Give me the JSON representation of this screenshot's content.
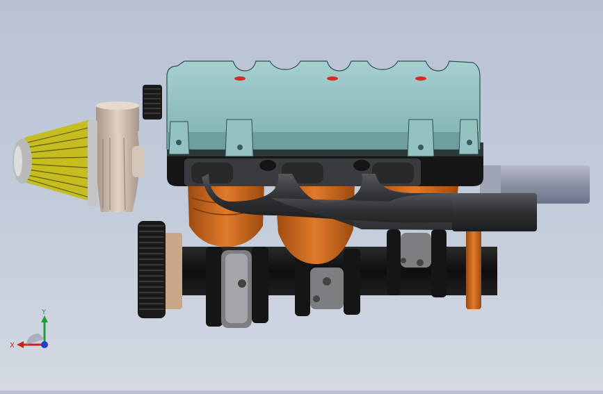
{
  "viewport": {
    "colors": {
      "background_top": "#b8c2d4",
      "background_bottom": "#d4d9e2",
      "valve_cover": "#8fbdbd",
      "valve_cover_dark": "#5f8f8f",
      "head_black": "#1a1a1a",
      "exhaust_pipe": "#3a3a3c",
      "copper": "#c8661b",
      "air_filter": "#b8b018",
      "turbo_housing": "#c9b8a8",
      "intake_pipe": "#8b8fa2"
    }
  },
  "triad": {
    "x_label": "X",
    "y_label": "Y",
    "icons": [
      "x-axis-arrow-icon",
      "y-axis-arrow-icon",
      "z-axis-origin-icon"
    ]
  }
}
